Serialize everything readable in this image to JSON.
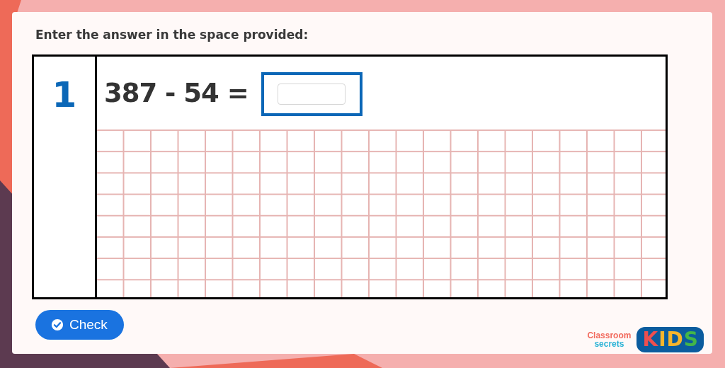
{
  "instruction": "Enter the answer in the space provided:",
  "question": {
    "number": "1",
    "expression": "387 - 54 ="
  },
  "check_button": {
    "label": "Check"
  },
  "logo": {
    "brand_lines": [
      "Classroom",
      "secrets"
    ],
    "badge_letters": [
      {
        "text": "K",
        "color": "#ee4f4f"
      },
      {
        "text": "I",
        "color": "#f7b52c"
      },
      {
        "text": "D",
        "color": "#f7b52c"
      },
      {
        "text": "S",
        "color": "#43b649"
      }
    ]
  }
}
